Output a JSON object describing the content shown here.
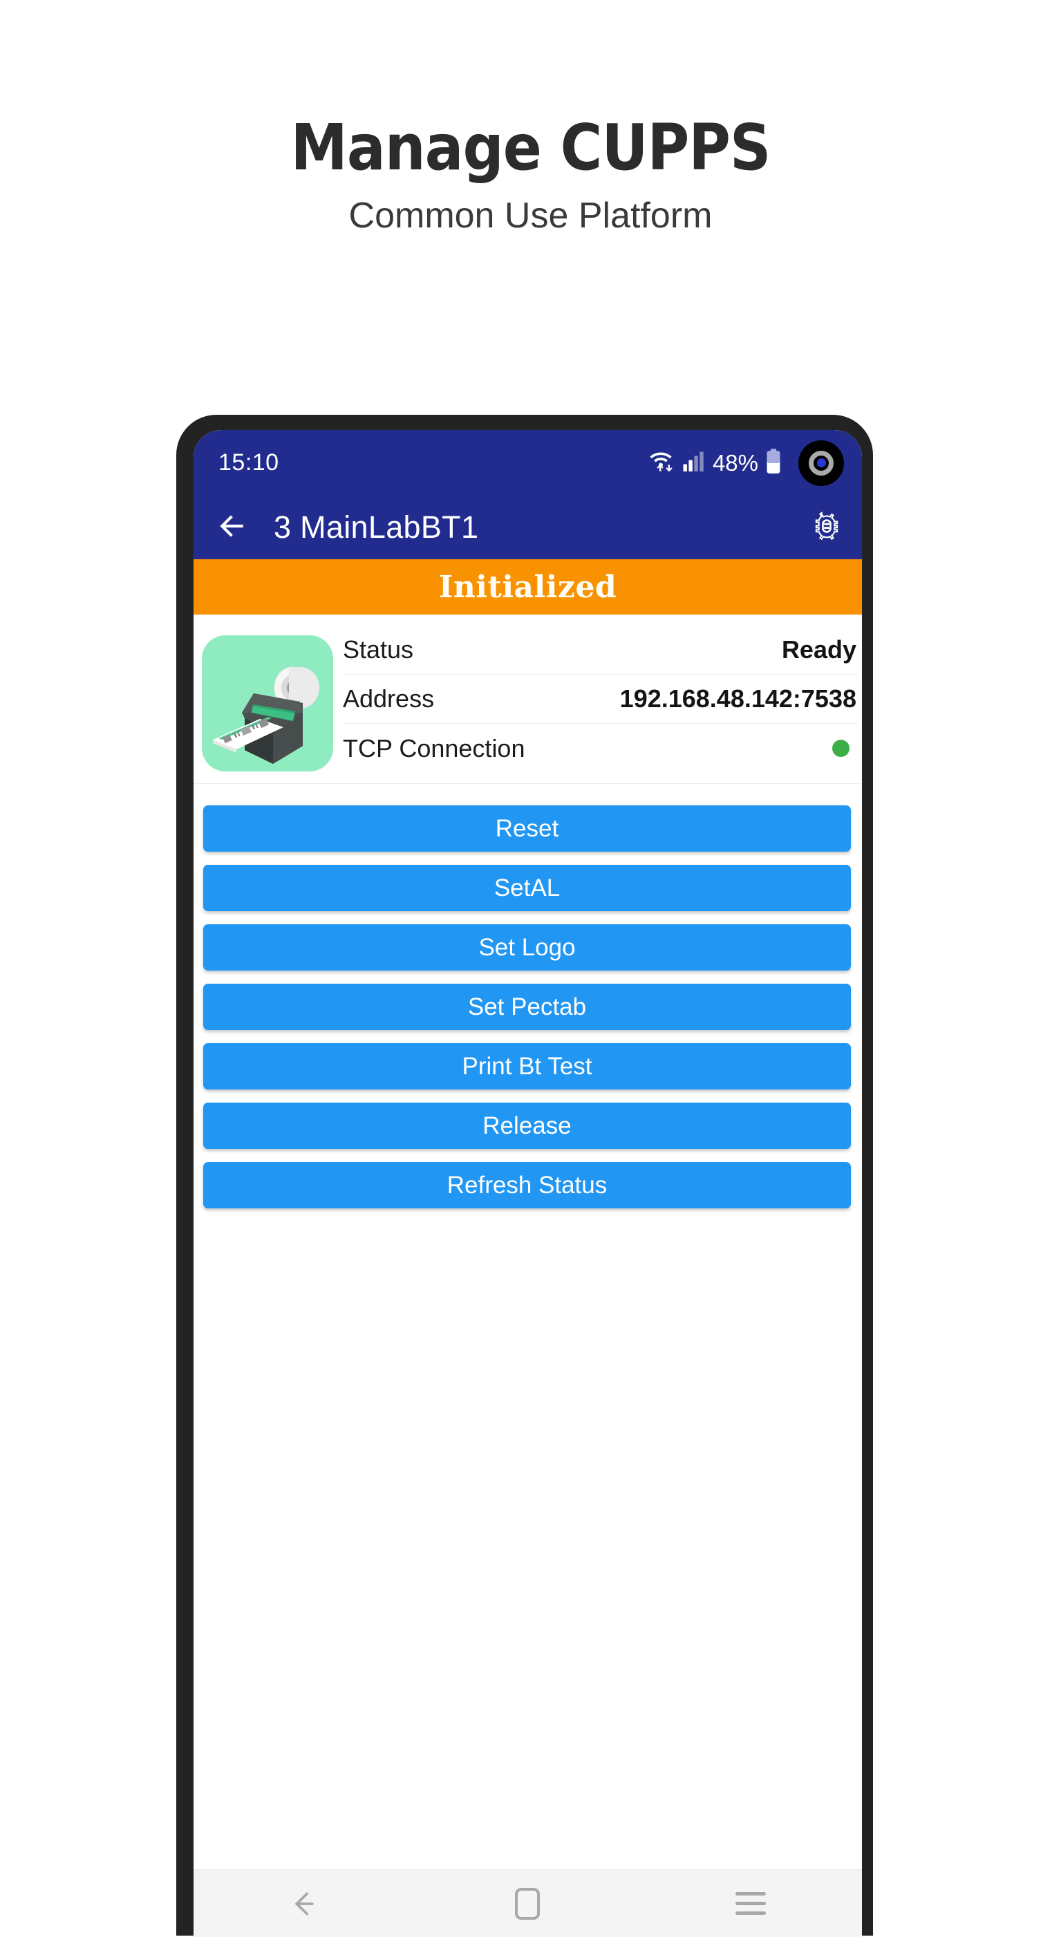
{
  "promo": {
    "title": "Manage CUPPS",
    "subtitle": "Common Use Platform"
  },
  "phone": {
    "statusbar": {
      "time": "15:10",
      "battery_percent": "48%",
      "wifi_icon": "wifi-updown-icon",
      "signal_icon": "cellular-signal-icon",
      "battery_icon": "battery-icon",
      "camera_icon": "front-camera-punchhole-icon"
    },
    "appbar": {
      "back_icon": "arrow-left-icon",
      "title": "3 MainLabBT1",
      "debug_icon": "bug-icon",
      "background_color": "#212c8e"
    },
    "banner": {
      "text": "Initialized",
      "background_color": "#f99200"
    },
    "device_card": {
      "printer_icon": "boarding-pass-printer-icon",
      "tile_color": "#8fecc0",
      "rows": [
        {
          "label": "Status",
          "value": "Ready",
          "type": "text"
        },
        {
          "label": "Address",
          "value": "192.168.48.142:7538",
          "type": "text"
        },
        {
          "label": "TCP Connection",
          "value": "",
          "type": "status-dot",
          "dot_color": "#3cae45"
        }
      ]
    },
    "actions": {
      "accent_color": "#2196f3",
      "buttons": [
        {
          "label": "Reset"
        },
        {
          "label": "SetAL"
        },
        {
          "label": "Set Logo"
        },
        {
          "label": "Set Pectab"
        },
        {
          "label": "Print Bt Test"
        },
        {
          "label": "Release"
        },
        {
          "label": "Refresh Status"
        }
      ]
    },
    "navbar": {
      "back_icon": "nav-back-icon",
      "home_icon": "nav-home-icon",
      "recents_icon": "nav-recents-icon"
    }
  }
}
